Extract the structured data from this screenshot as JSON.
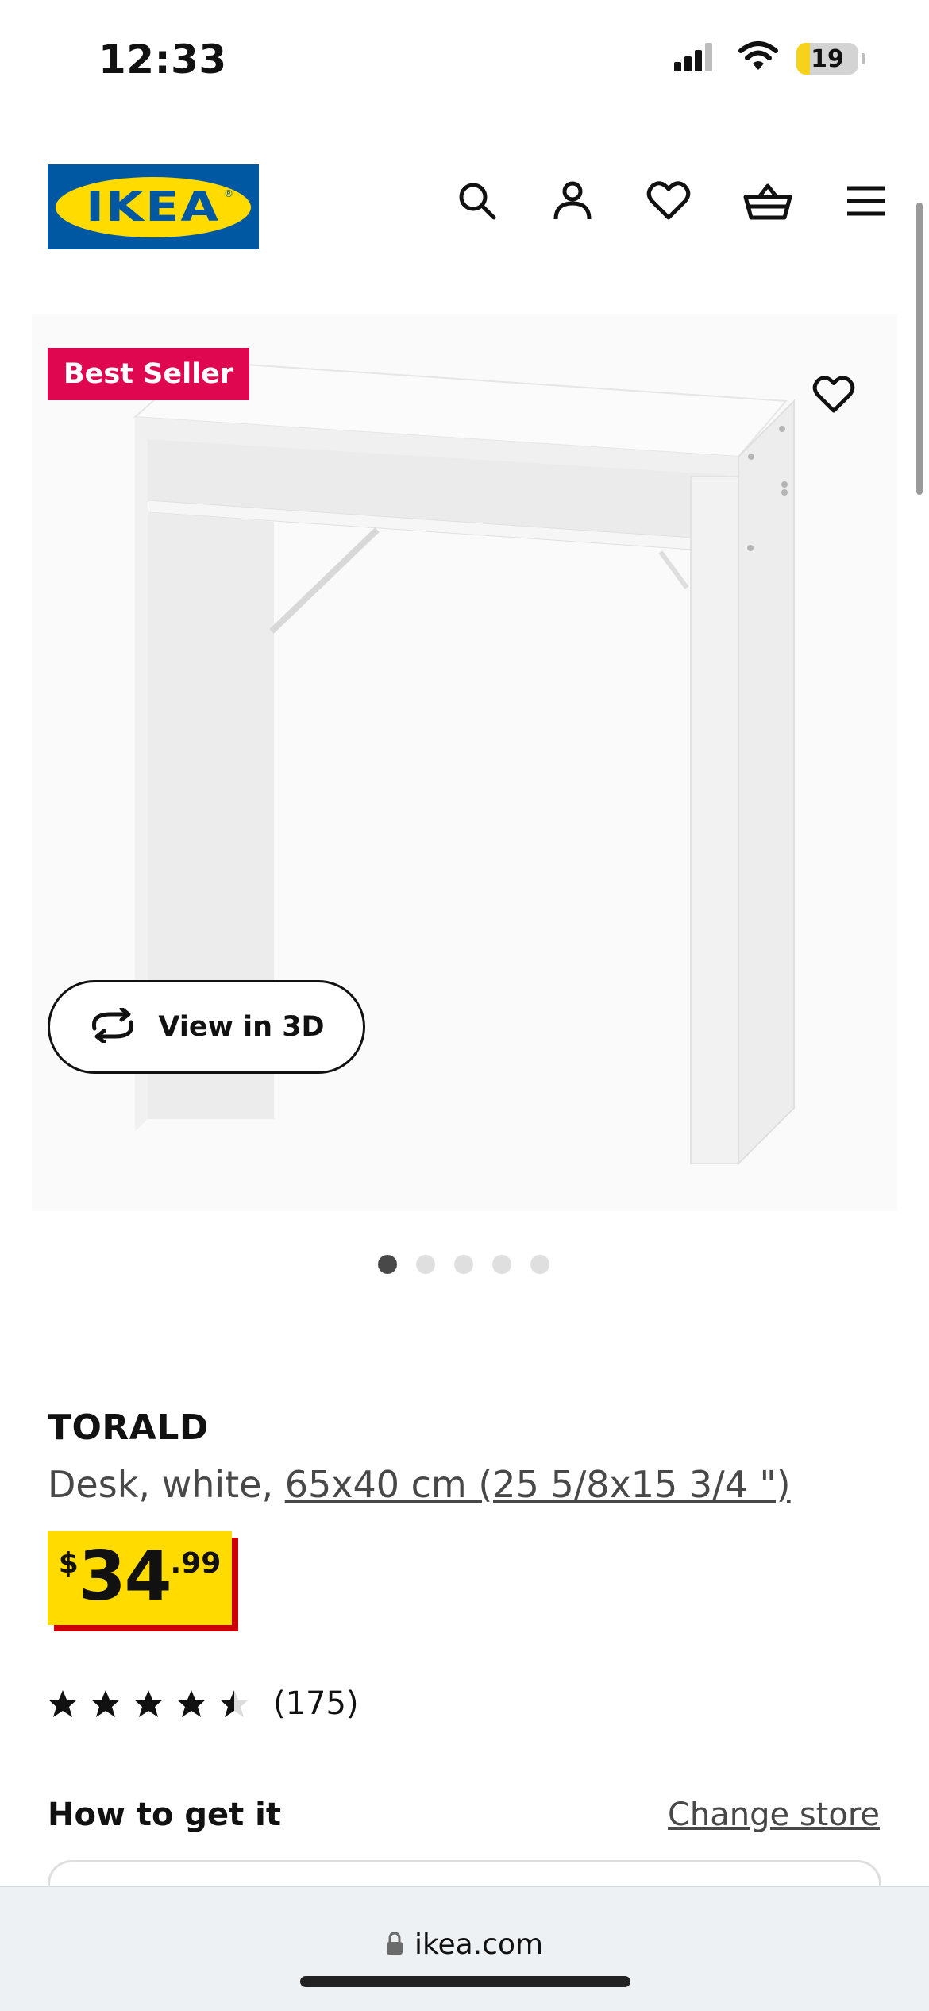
{
  "status_bar": {
    "time": "12:33",
    "battery_level": "19"
  },
  "header": {
    "logo_text": "IKEA",
    "logo_registered": "®",
    "brand_colors": {
      "blue": "#0058a3",
      "yellow": "#ffdb00"
    },
    "icons": [
      "search-icon",
      "account-icon",
      "wishlist-icon",
      "cart-icon",
      "menu-icon"
    ]
  },
  "gallery": {
    "badge": "Best Seller",
    "badge_color": "#e00751",
    "view_3d_label": "View in 3D",
    "image_count": 5,
    "active_image_index": 0
  },
  "product": {
    "name": "TORALD",
    "description_prefix": "Desk, white, ",
    "dimensions_link": "65x40 cm (25 5/8x15 3/4 \")",
    "price": {
      "currency": "$",
      "whole": "34",
      "decimal": ".99"
    },
    "rating": {
      "stars": 4.5,
      "count": "(175)"
    }
  },
  "fulfilment": {
    "title": "How to get it",
    "change_store_link": "Change store"
  },
  "browser": {
    "url": "ikea.com"
  }
}
